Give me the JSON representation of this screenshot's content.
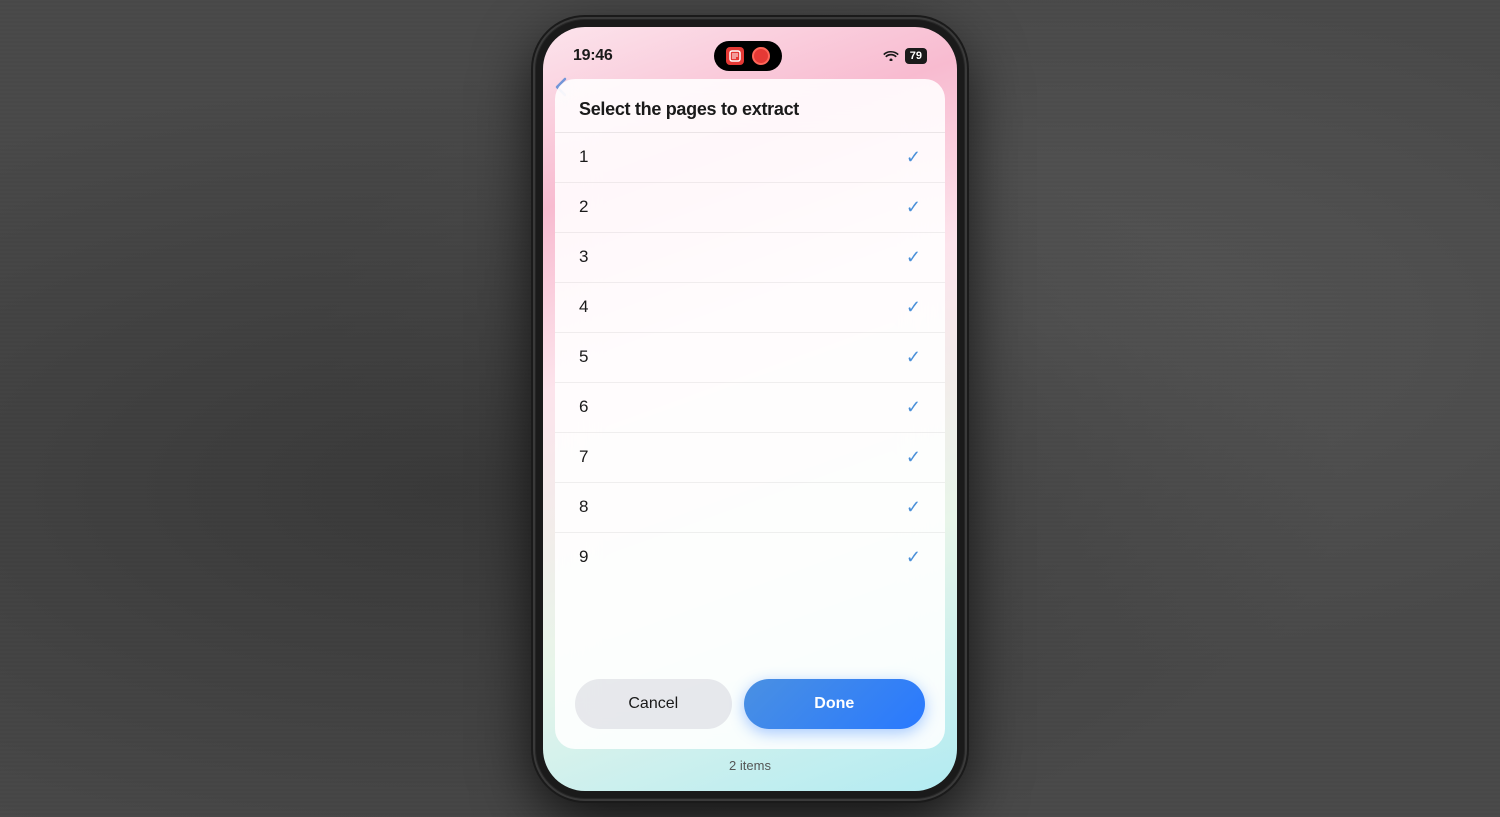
{
  "statusBar": {
    "time": "19:46",
    "batteryLevel": "79",
    "batteryIcon": "79"
  },
  "modal": {
    "title": "Select the pages to extract",
    "pages": [
      {
        "number": "1",
        "selected": true
      },
      {
        "number": "2",
        "selected": true
      },
      {
        "number": "3",
        "selected": true
      },
      {
        "number": "4",
        "selected": true
      },
      {
        "number": "5",
        "selected": true
      },
      {
        "number": "6",
        "selected": true
      },
      {
        "number": "7",
        "selected": true
      },
      {
        "number": "8",
        "selected": true
      },
      {
        "number": "9",
        "selected": true
      }
    ],
    "cancelLabel": "Cancel",
    "doneLabel": "Done",
    "itemsCount": "2 items"
  }
}
